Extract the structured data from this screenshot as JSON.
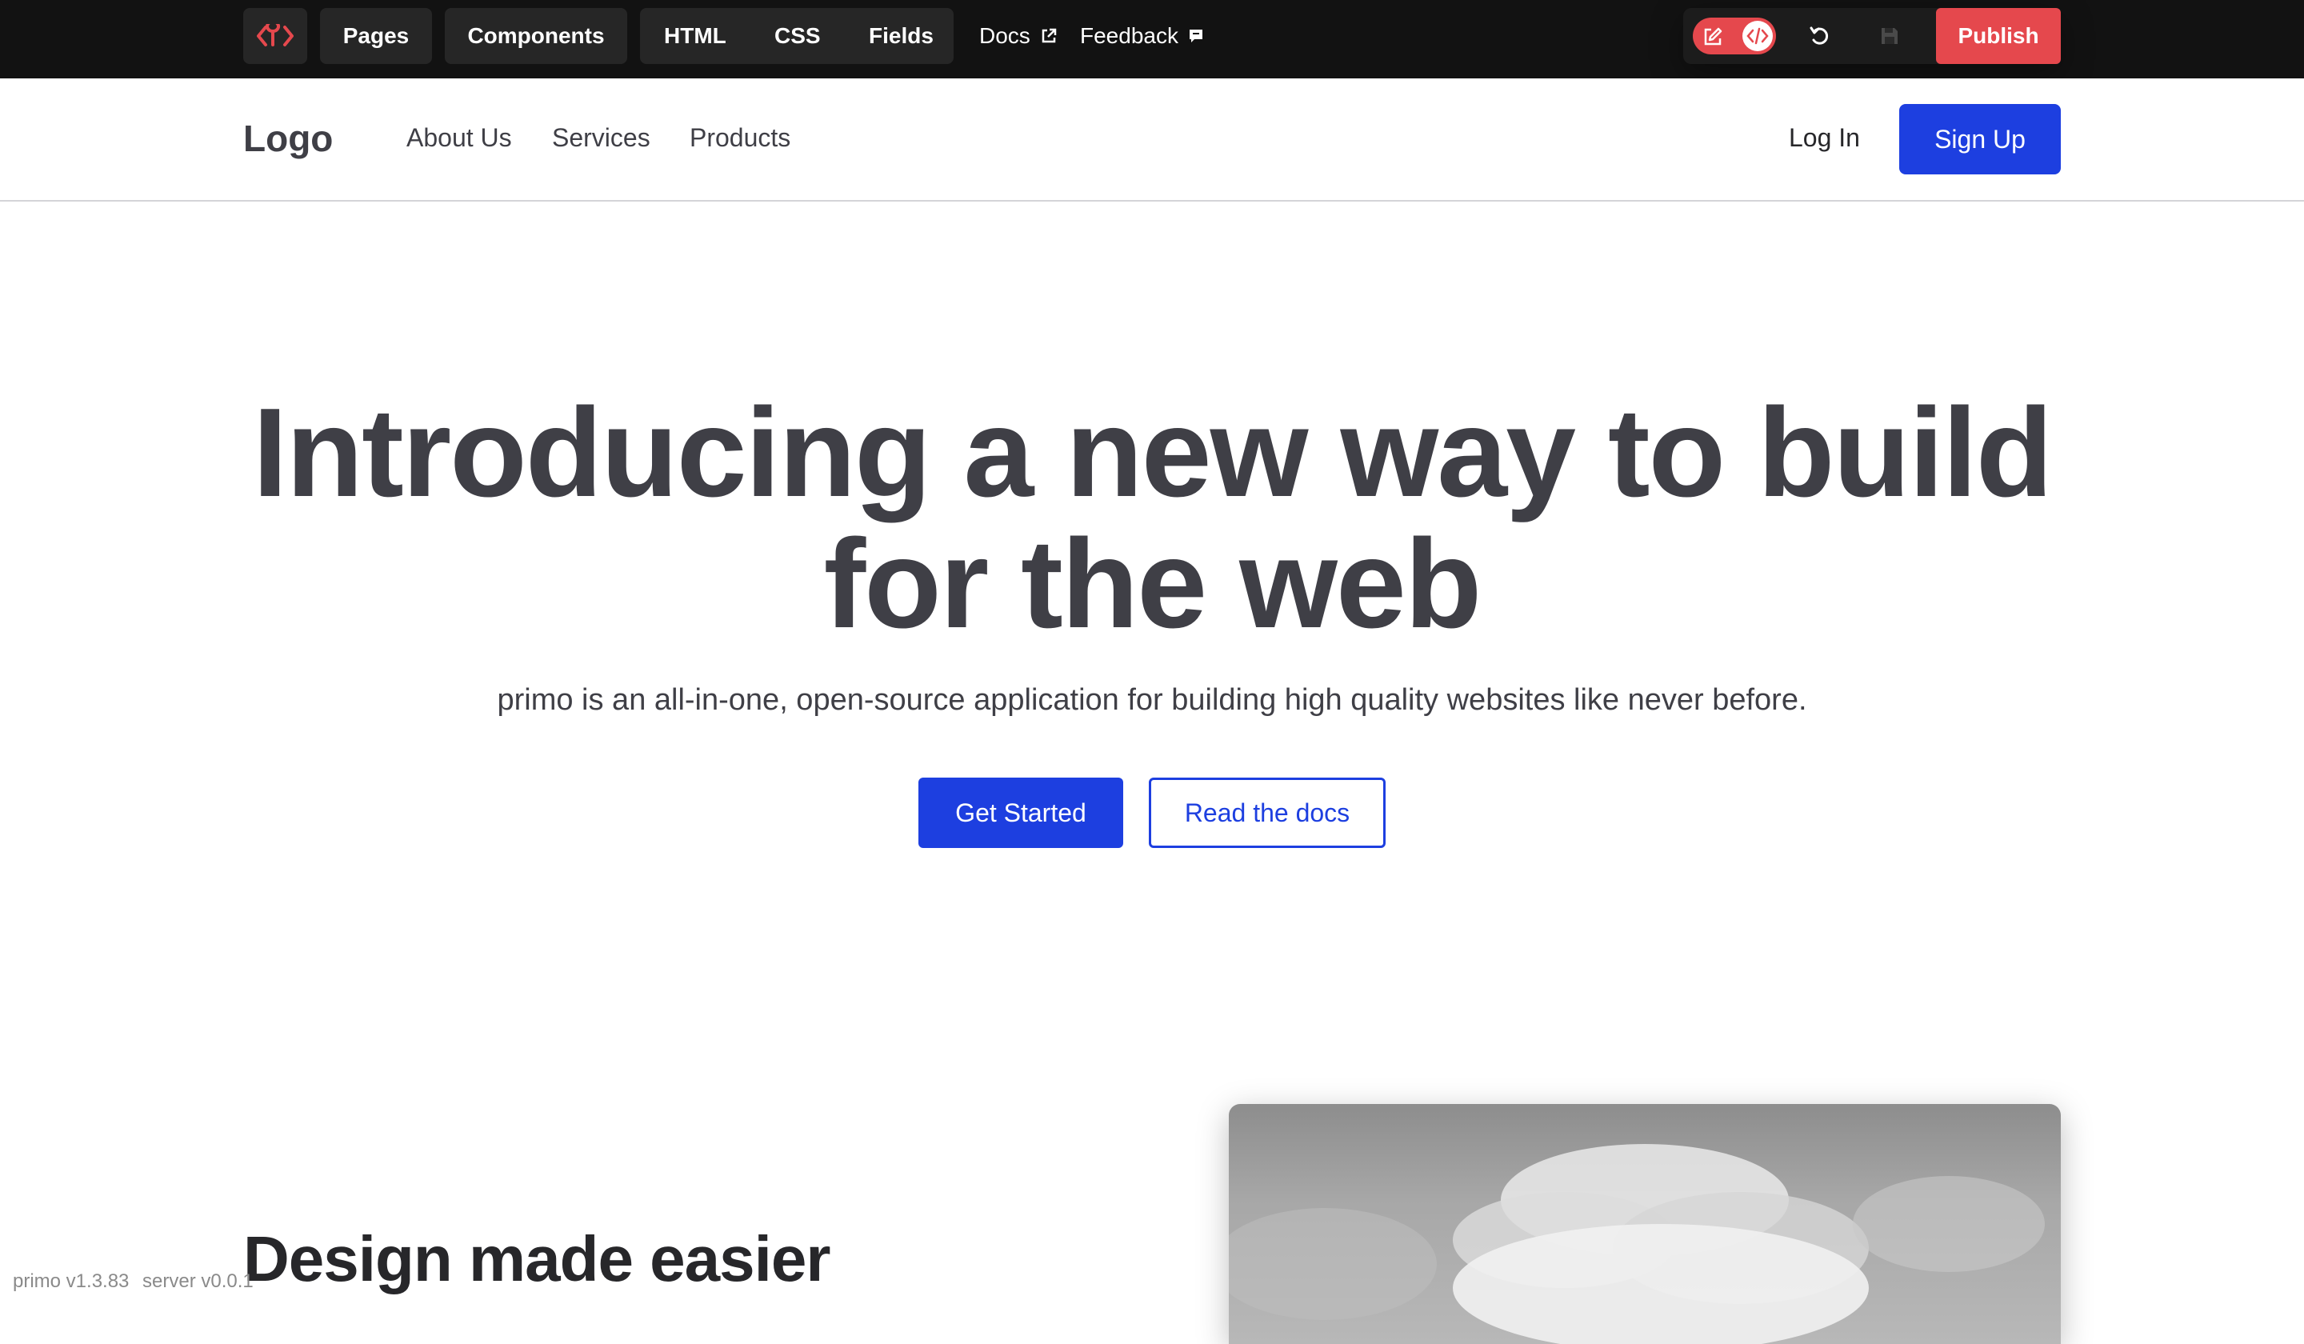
{
  "toolbar": {
    "logo_icon": "primo-code-icon",
    "pages": "Pages",
    "components": "Components",
    "html": "HTML",
    "css": "CSS",
    "fields": "Fields",
    "docs": "Docs",
    "feedback": "Feedback",
    "publish": "Publish",
    "accent": "#e5484d"
  },
  "site_nav": {
    "logo": "Logo",
    "links": [
      "About Us",
      "Services",
      "Products"
    ],
    "login": "Log In",
    "signup": "Sign Up",
    "brand_color": "#1d3fe0"
  },
  "hero": {
    "title": "Introducing a new way to build for the web",
    "subtitle": "primo is an all-in-one, open-source application for building high quality websites like never before.",
    "primary_cta": "Get Started",
    "secondary_cta": "Read the docs"
  },
  "feature": {
    "title": "Design made easier"
  },
  "footer": {
    "version": "primo v1.3.83",
    "server": "server v0.0.1"
  }
}
